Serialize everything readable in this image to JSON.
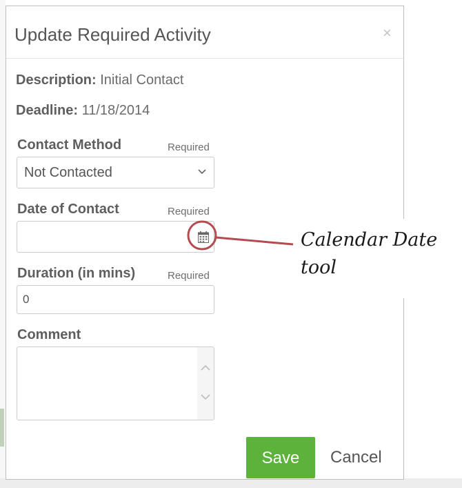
{
  "modal": {
    "title": "Update Required Activity",
    "close_glyph": "×"
  },
  "info": {
    "description_label": "Description:",
    "description_value": "Initial Contact",
    "deadline_label": "Deadline:",
    "deadline_value": "11/18/2014"
  },
  "fields": {
    "contact_method": {
      "label": "Contact Method",
      "required": "Required",
      "value": "Not Contacted"
    },
    "date_of_contact": {
      "label": "Date of Contact",
      "required": "Required",
      "value": ""
    },
    "duration": {
      "label": "Duration (in mins)",
      "required": "Required",
      "value": "0"
    },
    "comment": {
      "label": "Comment",
      "value": ""
    }
  },
  "buttons": {
    "save": "Save",
    "cancel": "Cancel"
  },
  "annotation": {
    "line1": "Calendar Date",
    "line2": "tool",
    "color": "#b54a4f"
  },
  "colors": {
    "save_button": "#5cb23a",
    "label_text": "#5e5e5e"
  },
  "icons": {
    "close": "close-icon",
    "select_chevron": "chevron-down-icon",
    "calendar": "calendar-icon",
    "scroll_up": "chevron-up-icon",
    "scroll_down": "chevron-down-icon"
  }
}
